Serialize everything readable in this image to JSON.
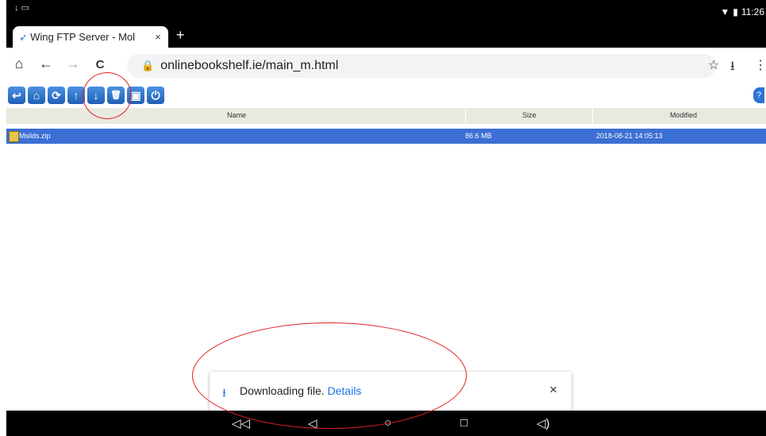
{
  "status_bar": {
    "left_icons": "↓ ▭",
    "time": "11:26",
    "wifi": "▼",
    "battery": "▮"
  },
  "browser": {
    "tab": {
      "title": "Wing FTP Server - Mol",
      "close": "×"
    },
    "new_tab": "+",
    "url": "onlinebookshelf.ie/main_m.html",
    "nav_icons": {
      "home": "⌂",
      "back": "←",
      "forward": "→",
      "reload": "C"
    },
    "right_icons": {
      "star": "☆",
      "download": "⭳",
      "menu": "⋮"
    }
  },
  "ftp_toolbar": {
    "buttons": [
      {
        "name": "back-button",
        "glyph": "↩"
      },
      {
        "name": "home-button",
        "glyph": "⌂"
      },
      {
        "name": "refresh-button",
        "glyph": "⟳"
      },
      {
        "name": "upload-button",
        "glyph": "↑"
      },
      {
        "name": "download-button",
        "glyph": "↓"
      },
      {
        "name": "delete-button",
        "glyph": "🗑"
      },
      {
        "name": "properties-button",
        "glyph": "▣"
      },
      {
        "name": "logout-button",
        "glyph": "⏻"
      }
    ],
    "help": "?"
  },
  "file_table": {
    "columns": [
      "Name",
      "Size",
      "Modified"
    ],
    "rows": [
      {
        "name": "Msilds.zip",
        "size": "86.6 MB",
        "modified": "2018-08-21 14:05:13"
      }
    ]
  },
  "snackbar": {
    "icon": "⭳",
    "text": "Downloading file. ",
    "link": "Details",
    "close": "×"
  },
  "android_nav": {
    "vol_down": "◁◁",
    "back": "◁",
    "home": "○",
    "recents": "□",
    "vol_up": "◁)"
  }
}
